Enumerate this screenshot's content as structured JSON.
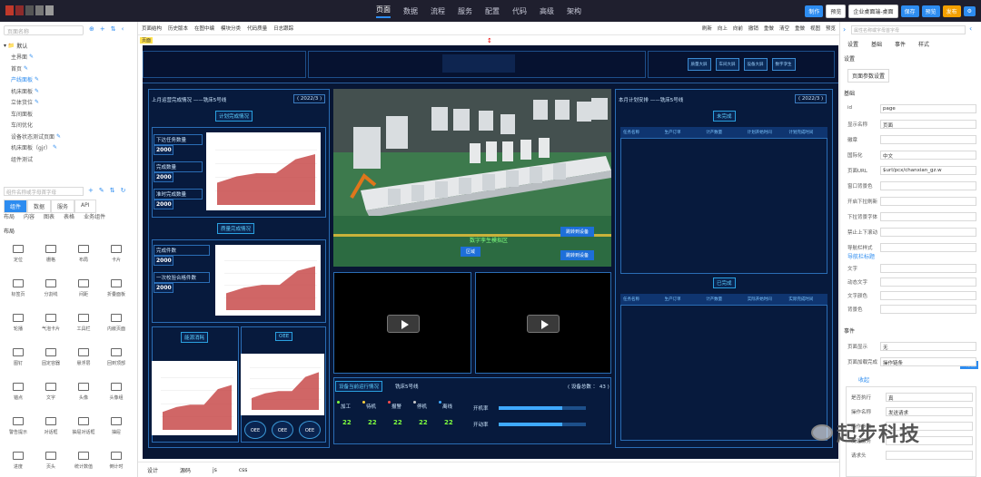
{
  "topnav": {
    "items": [
      "页面",
      "数据",
      "流程",
      "服务",
      "配置",
      "代码",
      "高级",
      "架构"
    ]
  },
  "top_right": {
    "btn1": "制作",
    "btn2": "预览",
    "env": "企业桌面端-桌面",
    "save": "保存",
    "preview": "预览",
    "publish": "发布"
  },
  "left": {
    "search_placeholder": "页面名称",
    "tree": [
      {
        "label": "默认",
        "type": "group"
      },
      {
        "label": "主界面",
        "pen": true
      },
      {
        "label": "首页",
        "pen": true
      },
      {
        "label": "产线面板",
        "pen": true,
        "selected": true
      },
      {
        "label": "机床面板",
        "pen": true
      },
      {
        "label": "立体货位",
        "pen": true
      },
      {
        "label": "车间面板"
      },
      {
        "label": "车间优化"
      },
      {
        "label": "设备状态测试页面",
        "pen": true
      },
      {
        "label": "机床面板（gjr）",
        "pen": true
      },
      {
        "label": "组件测试"
      }
    ],
    "search2_placeholder": "组件名称或字母首字母",
    "tabs1": [
      "组件",
      "数据",
      "服务",
      "API"
    ],
    "tabs2": [
      "布局",
      "内容",
      "图表",
      "表格",
      "业务组件"
    ],
    "section": "布局",
    "components": [
      "定位",
      "栅格",
      "布局",
      "卡片",
      "标签页",
      "分割线",
      "间距",
      "折叠面板",
      "轮播",
      "气泡卡片",
      "工具栏",
      "内嵌页面",
      "图钉",
      "固定容器",
      "悬浮层",
      "回到顶部",
      "锚点",
      "文字",
      "头像",
      "头像组",
      "警告提示",
      "对话框",
      "抽屉对话框",
      "抽屉",
      "进度",
      "页头",
      "统计数值",
      "倒计时"
    ]
  },
  "toolbar": {
    "left": [
      "页面结构",
      "历史版本",
      "在图中编",
      "模块分类",
      "代码质量",
      "日志跟踪"
    ],
    "right": [
      "刷新",
      "向上",
      "向前",
      "撤销",
      "重做",
      "清空",
      "重做",
      "视图",
      "预览"
    ]
  },
  "page_chip": "页面",
  "dashboard": {
    "header_buttons": [
      "质量大屏",
      "车间大屏",
      "设备大屏",
      "数字孪生"
    ],
    "left_panel": {
      "title": "上月运营完成情况 ——铣床5号线",
      "year": "( 2022/3 )",
      "plan_tag": "计划完成情况",
      "kv1": [
        {
          "label": "下达任务数量",
          "value": "2000"
        },
        {
          "label": "完成数量",
          "value": "2000"
        },
        {
          "label": "准时完成数量",
          "value": "2000"
        }
      ],
      "quality_tag": "质量完成情况",
      "kv2": [
        {
          "label": "完成件数",
          "value": "2000"
        },
        {
          "label": "一次校验合格件数",
          "value": "2000"
        }
      ],
      "bottom_tags": [
        "能源消耗",
        "OEE"
      ],
      "oee_badges": [
        "OEE",
        "OEE",
        "OEE"
      ]
    },
    "center": {
      "scene_label": "数字孪生模拟区",
      "scene_buttons": [
        "跳转到设备",
        "跳转到设备"
      ],
      "scene_tag": "区域"
    },
    "device_panel": {
      "title": "设备当前运行情况",
      "line": "铣床5号线",
      "count": "( 设备总数 ： 43 )",
      "stats": [
        {
          "label": "加工",
          "value": "22"
        },
        {
          "label": "待机",
          "value": "22"
        },
        {
          "label": "报警",
          "value": "22"
        },
        {
          "label": "停机",
          "value": "22"
        },
        {
          "label": "离线",
          "value": "22"
        }
      ],
      "bars": [
        "开机率",
        "开动率"
      ]
    },
    "right_panel": {
      "title": "本月计划安排 ——铣床5号线",
      "year": "( 2022/3 )",
      "tag1": "未完成",
      "tag2": "已完成",
      "columns": [
        "任务名称",
        "生产订单",
        "计产数量",
        "计划开始时间",
        "计划完成时间"
      ],
      "columns2": [
        "任务名称",
        "生产订单",
        "计产数量",
        "实际开始时间",
        "实际完成时间"
      ]
    }
  },
  "bottom_tabs": [
    "设计",
    "源码",
    "js",
    "css"
  ],
  "right": {
    "search_placeholder": "属性名称或字母首字母",
    "tabs": [
      "设置",
      "基础",
      "事件",
      "样式"
    ],
    "sec1": "设置",
    "page_params_btn": "页面参数设置",
    "sec2": "基础",
    "props": [
      {
        "label": "id",
        "value": "page"
      },
      {
        "label": "显示名称",
        "value": "页面"
      },
      {
        "label": "徽章",
        "value": ""
      },
      {
        "label": "国际化",
        "value": "中文"
      },
      {
        "label": "页面URL",
        "value": "$url/pcx/chanxian_gz.w"
      },
      {
        "label": "窗口背景色",
        "value": ""
      },
      {
        "label": "开启下拉刷新",
        "value": ""
      },
      {
        "label": "下拉背景字体",
        "value": ""
      },
      {
        "label": "禁止上下滚动",
        "value": ""
      },
      {
        "label": "导航栏样式",
        "value": ""
      }
    ],
    "nav_link": "导航栏标题",
    "props2": [
      {
        "label": "文字",
        "value": ""
      },
      {
        "label": "动态文字",
        "value": ""
      },
      {
        "label": "文字颜色",
        "value": ""
      },
      {
        "label": "背景色",
        "value": ""
      }
    ],
    "sec3": "事件",
    "event_props": [
      {
        "label": "页面显示",
        "value": "无"
      },
      {
        "label": "页面加载完成",
        "value": "操作链条"
      }
    ],
    "add_btn": "+添加",
    "collapse": "收起",
    "event_box": [
      {
        "label": "是否执行",
        "value": "真"
      },
      {
        "label": "操作名称",
        "value": "发送请求"
      },
      {
        "label": "操作参数",
        "value": ""
      },
      {
        "label": "发送服务",
        "value": ""
      },
      {
        "label": "请求头",
        "value": ""
      }
    ]
  },
  "watermark": "起步科技",
  "colors": {
    "stage_bg": "#081634",
    "panel_border": "#2a6db5",
    "accent": "#2d8cf0"
  }
}
